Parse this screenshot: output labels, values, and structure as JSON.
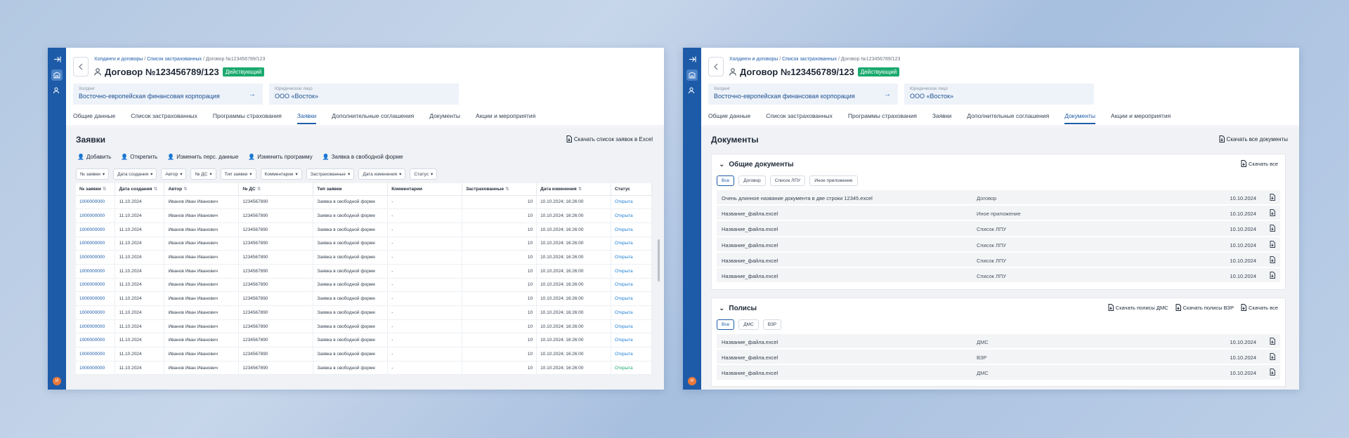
{
  "crumbs": {
    "c1": "Холдинги и договоры",
    "sep": " / ",
    "c2": "Список застрахованных",
    "c3": "Договор №123456789/123"
  },
  "contract": {
    "title": "Договор №123456789/123",
    "status": "Действующий"
  },
  "holding": {
    "label": "Холдинг",
    "value": "Восточно-европейская финансовая корпорация"
  },
  "legal": {
    "label": "Юридическое лицо",
    "value": "ООО «Восток»"
  },
  "tabs": [
    "Общие данные",
    "Список застрахованных",
    "Программы страхования",
    "Заявки",
    "Дополнительные соглашения",
    "Документы",
    "Акции и мероприятия"
  ],
  "requests": {
    "title": "Заявки",
    "download": "Скачать список заявок в Excel",
    "actions": [
      "Добавить",
      "Открепить",
      "Изменить перс. данные",
      "Изменить программу",
      "Заявка в свободной форме"
    ],
    "filters": [
      "№ заявки",
      "Дата создания",
      "Автор",
      "№ ДС",
      "Тип заявки",
      "Комментарии",
      "Застрахованные",
      "Дата изменения",
      "Статус"
    ],
    "columns": [
      "№ заявки",
      "Дата создания",
      "Автор",
      "№ ДС",
      "Тип заявки",
      "Комментарии",
      "Застрахованные",
      "Дата изменения",
      "Статус"
    ],
    "rows": [
      [
        "1000000000",
        "11.10.2024",
        "Иванов Иван Иванович",
        "1234567890",
        "Заявка в свободной форме",
        "-",
        "10",
        "10.10.2024; 16:26:00",
        "Открыта"
      ],
      [
        "1000000000",
        "11.10.2024",
        "Иванов Иван Иванович",
        "1234567890",
        "Заявка в свободной форме",
        "-",
        "10",
        "10.10.2024; 16:26:00",
        "Открыта"
      ],
      [
        "1000000000",
        "11.10.2024",
        "Иванов Иван Иванович",
        "1234567890",
        "Заявка в свободной форме",
        "-",
        "10",
        "10.10.2024; 16:26:00",
        "Открыта"
      ],
      [
        "1000000000",
        "11.10.2024",
        "Иванов Иван Иванович",
        "1234567890",
        "Заявка в свободной форме",
        "-",
        "10",
        "10.10.2024; 16:26:00",
        "Открыта"
      ],
      [
        "1000000000",
        "11.10.2024",
        "Иванов Иван Иванович",
        "1234567890",
        "Заявка в свободной форме",
        "-",
        "10",
        "10.10.2024; 16:26:00",
        "Открыта"
      ],
      [
        "1000000000",
        "11.10.2024",
        "Иванов Иван Иванович",
        "1234567890",
        "Заявка в свободной форме",
        "-",
        "10",
        "10.10.2024; 16:26:00",
        "Открыта"
      ],
      [
        "1000000000",
        "11.10.2024",
        "Иванов Иван Иванович",
        "1234567890",
        "Заявка в свободной форме",
        "-",
        "10",
        "10.10.2024; 16:26:00",
        "Открыта"
      ],
      [
        "1000000000",
        "11.10.2024",
        "Иванов Иван Иванович",
        "1234567890",
        "Заявка в свободной форме",
        "-",
        "10",
        "10.10.2024; 16:26:00",
        "Открыта"
      ],
      [
        "1000000000",
        "11.10.2024",
        "Иванов Иван Иванович",
        "1234567890",
        "Заявка в свободной форме",
        "-",
        "10",
        "10.10.2024; 16:26:00",
        "Открыта"
      ],
      [
        "1000000000",
        "11.10.2024",
        "Иванов Иван Иванович",
        "1234567890",
        "Заявка в свободной форме",
        "-",
        "10",
        "10.10.2024; 16:26:00",
        "Открыта"
      ],
      [
        "1000000000",
        "11.10.2024",
        "Иванов Иван Иванович",
        "1234567890",
        "Заявка в свободной форме",
        "-",
        "10",
        "10.10.2024; 16:26:00",
        "Открыта"
      ],
      [
        "1000000000",
        "11.10.2024",
        "Иванов Иван Иванович",
        "1234567890",
        "Заявка в свободной форме",
        "-",
        "10",
        "10.10.2024; 16:26:00",
        "Открыта"
      ],
      [
        "1000000000",
        "11.10.2024",
        "Иванов Иван Иванович",
        "1234567890",
        "Заявка в свободной форме",
        "-",
        "10",
        "10.10.2024; 16:26:00",
        "Открыта"
      ]
    ]
  },
  "documents": {
    "title": "Документы",
    "download_all": "Скачать все документы",
    "general": {
      "title": "Общие документы",
      "download": "Скачать все",
      "chips": [
        "Все",
        "Договор",
        "Список ЛПУ",
        "Иное приложение"
      ],
      "rows": [
        [
          "Очень длинное название документа в две строки 12345.excel",
          "Договор",
          "10.10.2024"
        ],
        [
          "Название_файла.excel",
          "Иное приложение",
          "10.10.2024"
        ],
        [
          "Название_файла.excel",
          "Список ЛПУ",
          "10.10.2024"
        ],
        [
          "Название_файла.excel",
          "Список ЛПУ",
          "10.10.2024"
        ],
        [
          "Название_файла.excel",
          "Список ЛПУ",
          "10.10.2024"
        ],
        [
          "Название_файла.excel",
          "Список ЛПУ",
          "10.10.2024"
        ]
      ]
    },
    "policies": {
      "title": "Полисы",
      "dl_dms": "Скачать полисы ДМС",
      "dl_vzr": "Скачать полисы ВЗР",
      "dl_all": "Скачать все",
      "chips": [
        "Все",
        "ДМС",
        "ВЗР"
      ],
      "rows": [
        [
          "Название_файла.excel",
          "ДМС",
          "10.10.2024"
        ],
        [
          "Название_файла.excel",
          "ВЗР",
          "10.10.2024"
        ],
        [
          "Название_файла.excel",
          "ДМС",
          "10.10.2024"
        ]
      ]
    }
  },
  "logo_text": "И",
  "colors": {
    "brand": "#1d5ba8",
    "success": "#1aa96e"
  }
}
